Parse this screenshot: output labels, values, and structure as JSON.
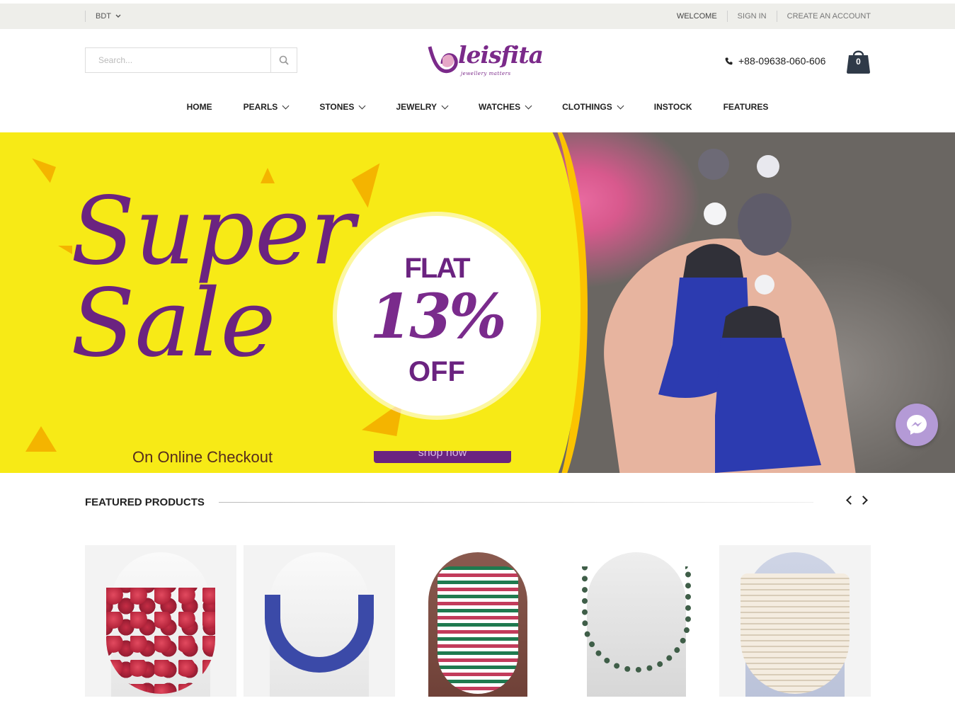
{
  "topbar": {
    "currency": "BDT",
    "welcome": "WELCOME",
    "sign_in": "SIGN IN",
    "create_account": "CREATE AN ACCOUNT"
  },
  "header": {
    "search_placeholder": "Search...",
    "logo_text": "leisfita",
    "logo_tagline": "jewellery matters",
    "phone": "+88-09638-060-606",
    "cart_count": "0"
  },
  "nav": [
    {
      "label": "HOME",
      "dropdown": false
    },
    {
      "label": "PEARLS",
      "dropdown": true
    },
    {
      "label": "STONES",
      "dropdown": true
    },
    {
      "label": "JEWELRY",
      "dropdown": true
    },
    {
      "label": "WATCHES",
      "dropdown": true
    },
    {
      "label": "CLOTHINGS",
      "dropdown": true
    },
    {
      "label": "INSTOCK",
      "dropdown": false
    },
    {
      "label": "FEATURES",
      "dropdown": false
    }
  ],
  "banner": {
    "line1": "Super",
    "line2": "Sale",
    "flat": "FLAT",
    "percent": "13%",
    "off": "OFF",
    "checkout": "On Online Checkout",
    "shop_now": "shop now"
  },
  "featured": {
    "title": "FEATURED PRODUCTS",
    "products": [
      {
        "name": "red-stone-necklace",
        "color": "#c62d45"
      },
      {
        "name": "blue-pearl-necklace",
        "color": "#3b4aa8"
      },
      {
        "name": "multi-strand-bead-necklace",
        "color": "#1f7a4f"
      },
      {
        "name": "green-abalone-necklace",
        "color": "#3f5e48"
      },
      {
        "name": "white-pearl-multistrand-necklace",
        "color": "#eee3d1"
      }
    ]
  },
  "colors": {
    "brand": "#7b2a8a",
    "banner_yellow": "#f7ea16",
    "topbar_bg": "#eeeeea"
  }
}
